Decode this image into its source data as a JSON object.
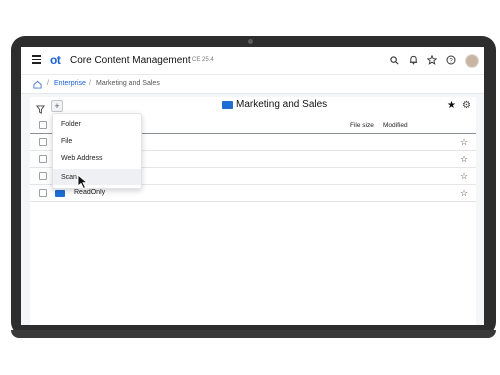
{
  "app": {
    "logo_text": "ot",
    "title": "Core Content Management",
    "version": "CE 25.4"
  },
  "toolbar_icons": [
    "search-icon",
    "bell-icon",
    "star-icon",
    "help-icon",
    "avatar"
  ],
  "breadcrumb": {
    "items": [
      "Enterprise",
      "Marketing and Sales"
    ]
  },
  "folder": {
    "title": "Marketing and Sales"
  },
  "table": {
    "columns": [
      "File size",
      "Modified"
    ],
    "rows": [
      {
        "name": ""
      },
      {
        "name": ""
      },
      {
        "name": ""
      },
      {
        "name": "ReadOnly"
      }
    ]
  },
  "add_menu": {
    "items": [
      "Folder",
      "File",
      "Web Address",
      "Scan"
    ],
    "hovered": "Scan"
  },
  "colors": {
    "accent": "#1a61d6",
    "folder": "#1f6ed4"
  }
}
